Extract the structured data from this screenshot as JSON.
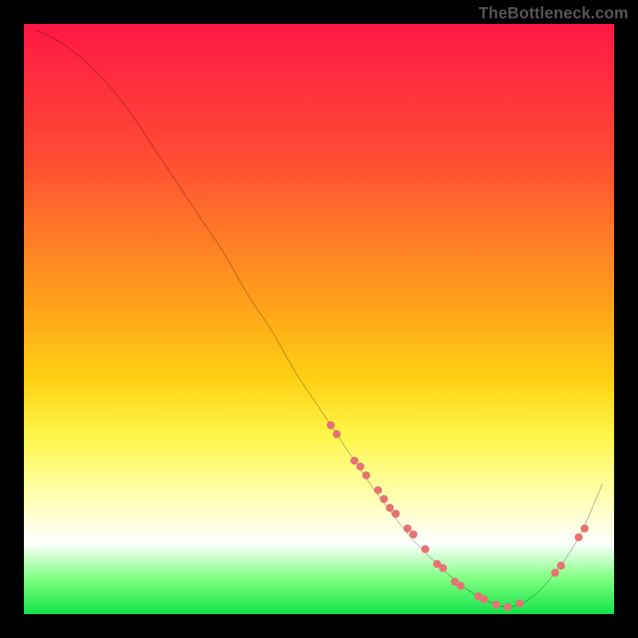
{
  "watermark": "TheBottleneck.com",
  "chart_data": {
    "type": "line",
    "title": "",
    "xlabel": "",
    "ylabel": "",
    "xlim": [
      0,
      100
    ],
    "ylim": [
      0,
      100
    ],
    "grid": false,
    "legend": false,
    "series": [
      {
        "name": "curve",
        "color": "#000000",
        "x": [
          2,
          6,
          10,
          14,
          18,
          22,
          26,
          30,
          34,
          38,
          42,
          46,
          50,
          54,
          58,
          62,
          66,
          70,
          74,
          78,
          82,
          86,
          90,
          94,
          98
        ],
        "y": [
          99,
          97,
          94,
          90,
          85,
          79,
          73,
          67,
          61,
          54,
          48,
          41,
          35,
          29,
          23,
          17.5,
          12.5,
          8.5,
          5,
          2.5,
          1.2,
          2.8,
          7,
          13,
          22
        ]
      }
    ],
    "scatter_points": {
      "name": "markers",
      "color": "#e57373",
      "radius": 5,
      "x": [
        52,
        53,
        56,
        57,
        58,
        60,
        61,
        62,
        63,
        65,
        66,
        68,
        70,
        71,
        73,
        74,
        77,
        78,
        80,
        82,
        84,
        90,
        91,
        94,
        95
      ],
      "y": [
        32,
        30.5,
        26,
        25,
        23.5,
        21,
        19.5,
        18,
        17,
        14.5,
        13.5,
        11,
        8.5,
        7.8,
        5.5,
        4.8,
        3,
        2.5,
        1.6,
        1.2,
        1.8,
        7,
        8.2,
        13,
        14.5
      ]
    },
    "background": {
      "gradient_stops": [
        {
          "pos": 0.0,
          "color": "#ff1744"
        },
        {
          "pos": 0.22,
          "color": "#ff4a34"
        },
        {
          "pos": 0.48,
          "color": "#ffa31a"
        },
        {
          "pos": 0.7,
          "color": "#fff64a"
        },
        {
          "pos": 0.88,
          "color": "#ffffff"
        },
        {
          "pos": 1.0,
          "color": "#13e24a"
        }
      ]
    }
  }
}
